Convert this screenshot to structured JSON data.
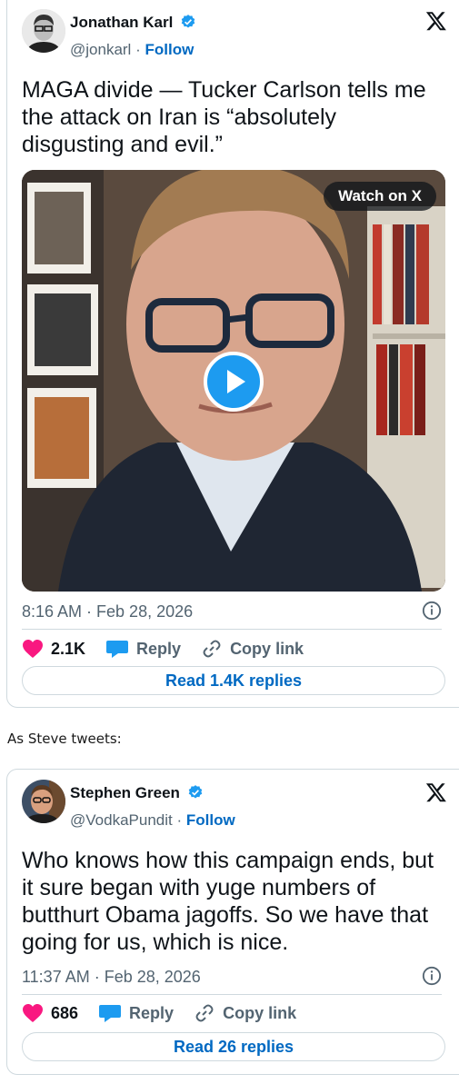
{
  "tweets": [
    {
      "author_name": "Jonathan Karl",
      "handle": "@jonkarl",
      "separator": "·",
      "follow_label": "Follow",
      "text": "MAGA divide — Tucker Carlson tells me the attack on Iran is “absolutely disgusting and evil.”",
      "video_button": "Watch on X",
      "timestamp": "8:16 AM · Feb 28, 2026",
      "likes": "2.1K",
      "reply_label": "Reply",
      "copy_label": "Copy link",
      "read_replies": "Read 1.4K replies"
    },
    {
      "author_name": "Stephen Green",
      "handle": "@VodkaPundit",
      "separator": "·",
      "follow_label": "Follow",
      "text": "Who knows how this campaign ends, but it sure began with yuge numbers of butthurt Obama jagoffs. So we have that going for us, which is nice.",
      "timestamp": "11:37 AM · Feb 28, 2026",
      "likes": "686",
      "reply_label": "Reply",
      "copy_label": "Copy link",
      "read_replies": "Read 26 replies"
    }
  ],
  "between_text": "As Steve tweets:",
  "colors": {
    "link": "#0069c2",
    "verified": "#1d9bf0",
    "like": "#f91880",
    "reply": "#1d9bf0",
    "muted": "#536471"
  },
  "icons": [
    "verified-badge-icon",
    "x-logo-icon",
    "info-icon",
    "heart-icon",
    "reply-bubble-icon",
    "link-icon",
    "play-icon"
  ]
}
